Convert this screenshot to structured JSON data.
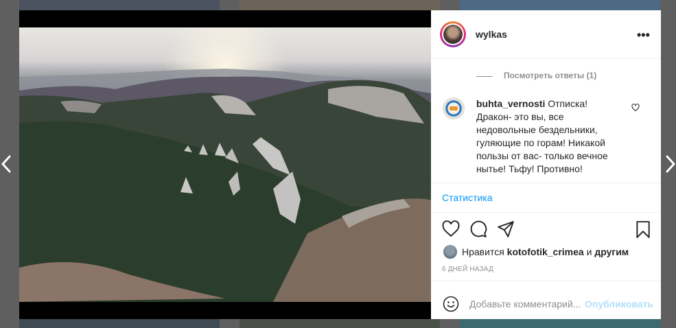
{
  "post": {
    "username": "wylkas",
    "more_label": "•••",
    "view_replies": "Посмотреть ответы (1)",
    "comment": {
      "username": "buhta_vernosti",
      "text": "Отписка! Дракон- это вы, все недовольные бездельники, гуляющие по горам! Никакой пользы от вас- только вечное нытье! Тьфу! Противно!"
    },
    "stats_link": "Статистика",
    "likes": {
      "prefix": "Нравится",
      "user": "kotofotik_crimea",
      "and_word": "и",
      "others": "другим"
    },
    "date": "6 ДНЕЙ НАЗАД",
    "comment_placeholder": "Добавьте комментарий...",
    "publish_label": "Опубликовать"
  },
  "icons": {
    "like": "heart-icon",
    "comment": "comment-icon",
    "share": "paper-plane-icon",
    "save": "bookmark-icon",
    "emoji": "smiley-icon",
    "prev": "chevron-left-icon",
    "next": "chevron-right-icon"
  },
  "colors": {
    "link": "#0095f6",
    "publish_disabled": "#b2dffc",
    "text": "#262626",
    "muted": "#8e8e8e"
  }
}
